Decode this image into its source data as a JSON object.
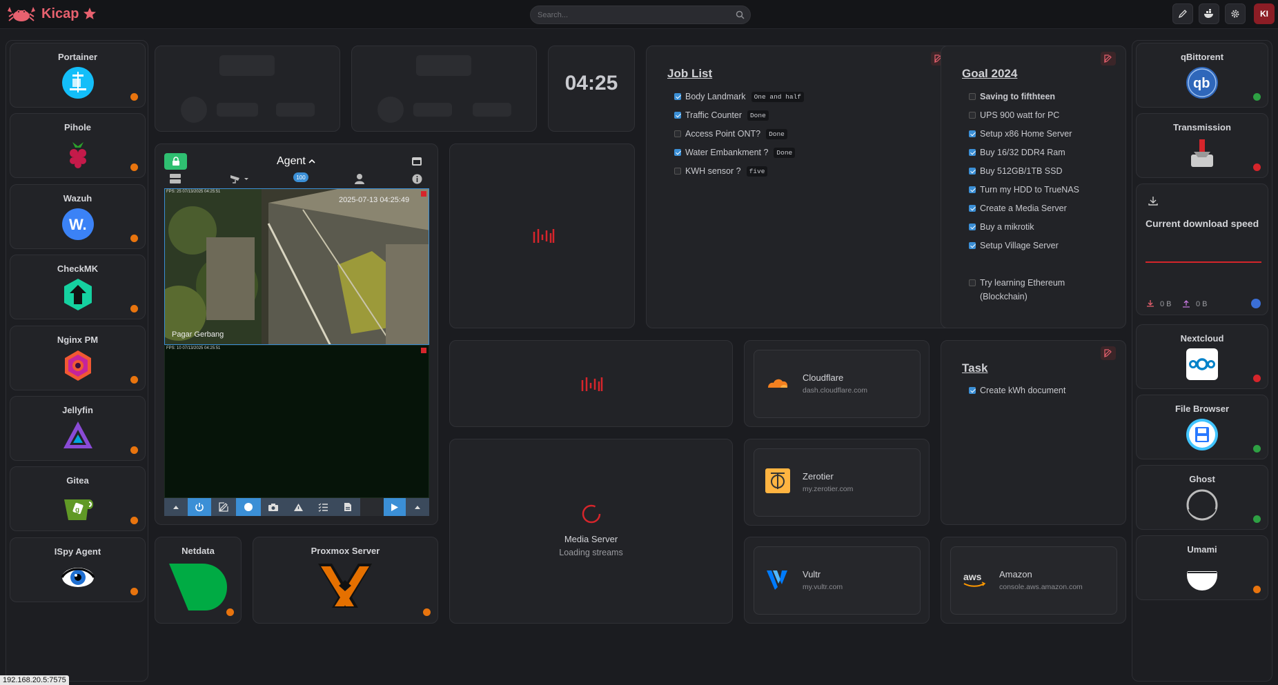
{
  "brand": {
    "name": "Kicap"
  },
  "search": {
    "placeholder": "Search..."
  },
  "user": {
    "initials": "KI"
  },
  "left_apps": [
    {
      "name": "Portainer",
      "status": "orange"
    },
    {
      "name": "Pihole",
      "status": "orange"
    },
    {
      "name": "Wazuh",
      "status": "orange"
    },
    {
      "name": "CheckMK",
      "status": "orange"
    },
    {
      "name": "Nginx PM",
      "status": "orange"
    },
    {
      "name": "Jellyfin",
      "status": "orange"
    },
    {
      "name": "Gitea",
      "status": "orange"
    },
    {
      "name": "ISpy Agent",
      "status": "orange"
    }
  ],
  "right_apps": [
    {
      "name": "qBittorent",
      "status": "green"
    },
    {
      "name": "Transmission",
      "status": "red"
    },
    {
      "name": "Nextcloud",
      "status": "red"
    },
    {
      "name": "File Browser",
      "status": "green"
    },
    {
      "name": "Ghost",
      "status": "green"
    },
    {
      "name": "Umami",
      "status": "orange"
    }
  ],
  "clock": {
    "time": "04:25"
  },
  "agent": {
    "title": "Agent",
    "badge": "100",
    "cam1": {
      "fps": "FPS: 25 07/13/2025 04:25:51",
      "timestamp": "2025-07-13 04:25:49",
      "label": "Pagar Gerbang"
    },
    "cam2": {
      "fps": "FPS: 10 07/13/2025 04:25:51"
    }
  },
  "job_list": {
    "title": "Job List",
    "items": [
      {
        "text": "Body Landmark",
        "tag": "One and half",
        "checked": true
      },
      {
        "text": "Traffic Counter",
        "tag": "Done",
        "checked": true
      },
      {
        "text": "Access Point ONT?",
        "tag": "Done",
        "checked": false
      },
      {
        "text": "Water Embankment ?",
        "tag": "Done",
        "checked": true
      },
      {
        "text": "KWH sensor ?",
        "tag": "five",
        "checked": false
      }
    ]
  },
  "goal": {
    "title": "Goal 2024",
    "items": [
      {
        "text": "Saving to fifthteen",
        "checked": false,
        "bold": true
      },
      {
        "text": "UPS 900 watt for PC",
        "checked": false
      },
      {
        "text": "Setup x86 Home Server",
        "checked": true
      },
      {
        "text": "Buy 16/32 DDR4 Ram",
        "checked": true
      },
      {
        "text": "Buy 512GB/1TB SSD",
        "checked": true
      },
      {
        "text": "Turn my HDD to TrueNAS",
        "checked": true
      },
      {
        "text": "Create a Media Server",
        "checked": true
      },
      {
        "text": "Buy a mikrotik",
        "checked": true
      },
      {
        "text": "Setup Village Server",
        "checked": true
      },
      {
        "text": "Try learning Ethereum",
        "text2": "(Blockchain)",
        "checked": false
      }
    ]
  },
  "task": {
    "title": "Task",
    "items": [
      {
        "text": "Create kWh document",
        "checked": true
      }
    ]
  },
  "download": {
    "title": "Current download speed",
    "down": "0 B",
    "up": "0 B"
  },
  "bookmarks": [
    {
      "name": "Cloudflare",
      "url": "dash.cloudflare.com"
    },
    {
      "name": "Zerotier",
      "url": "my.zerotier.com"
    },
    {
      "name": "Vultr",
      "url": "my.vultr.com"
    },
    {
      "name": "Amazon",
      "url": "console.aws.amazon.com"
    }
  ],
  "bottom_apps": [
    {
      "name": "Netdata",
      "status": "orange"
    },
    {
      "name": "Proxmox Server",
      "status": "orange"
    }
  ],
  "media": {
    "title": "Media Server",
    "subtitle": "Loading streams"
  },
  "statusbar": {
    "url": "192.168.20.5:7575"
  },
  "colors": {
    "accent": "#e8616f",
    "orange": "#e8740e",
    "red": "#d6252b",
    "green": "#2ea043",
    "link": "#3b8fd6"
  }
}
